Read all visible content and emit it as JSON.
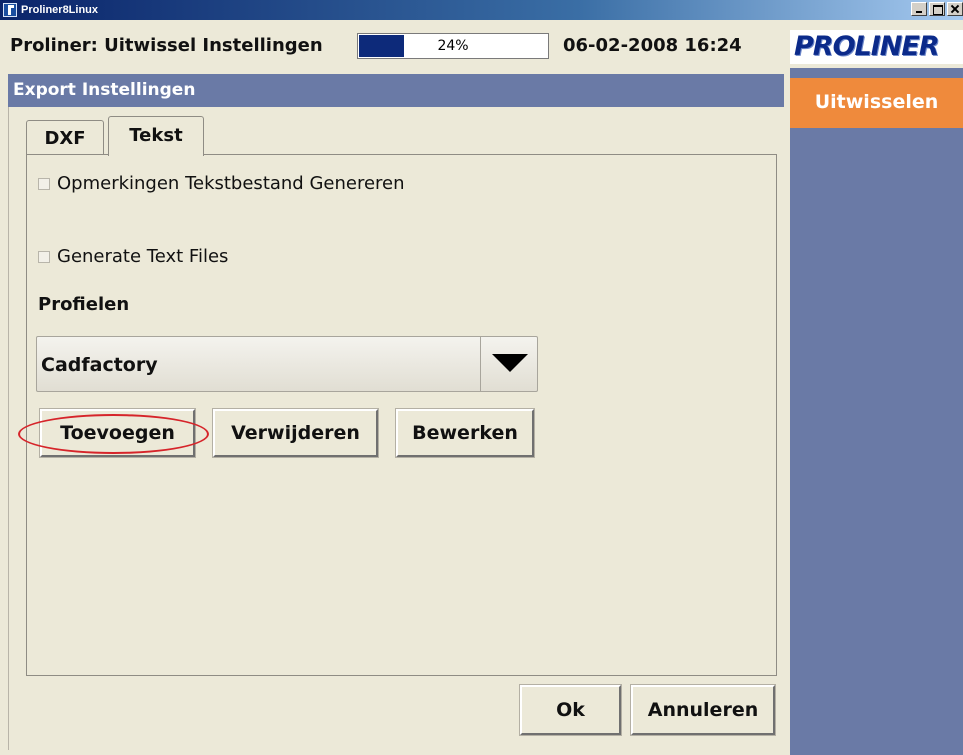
{
  "window": {
    "app_name": "Proliner8Linux"
  },
  "header": {
    "title": "Proliner: Uitwissel Instellingen",
    "progress_label": "24%",
    "progress_value": 0.24,
    "datetime": "06-02-2008 16:24",
    "logo_text": "PROLINER"
  },
  "panel": {
    "title": "Export Instellingen",
    "tabs": [
      {
        "label": "DXF"
      },
      {
        "label": "Tekst",
        "active": true
      }
    ],
    "options": [
      {
        "label": "Opmerkingen Tekstbestand Genereren",
        "checked": false
      },
      {
        "label": "Generate Text Files",
        "checked": false
      }
    ],
    "profiles_label": "Profielen",
    "profile_selected": "Cadfactory",
    "buttons": {
      "add": "Toevoegen",
      "remove": "Verwijderen",
      "edit": "Bewerken"
    },
    "footer": {
      "ok": "Ok",
      "cancel": "Annuleren"
    }
  },
  "side": {
    "button_label": "Uitwisselen"
  },
  "colors": {
    "panel_header": "#6a7aa6",
    "side_button": "#ef8a3c",
    "progress_fill": "#0d2a7a",
    "highlight": "#d6242a",
    "logo": "#0b2a8a"
  }
}
